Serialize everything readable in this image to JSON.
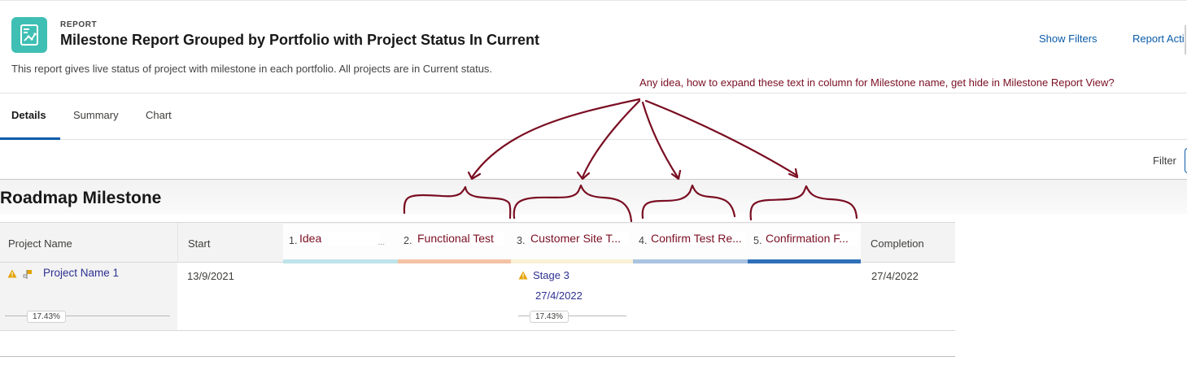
{
  "header": {
    "eyebrow": "REPORT",
    "title": "Milestone Report Grouped by Portfolio with Project Status In Current",
    "description": "This report gives live status of project with milestone in each portfolio. All projects are in Current status.",
    "show_filters": "Show Filters",
    "report_actions": "Report Acti",
    "icon": "report-chart-icon"
  },
  "annotation": "Any idea, how to expand these text in column for Milestone name, get hide in Milestone Report View?",
  "tabs": [
    {
      "label": "Details",
      "active": true
    },
    {
      "label": "Summary",
      "active": false
    },
    {
      "label": "Chart",
      "active": false
    }
  ],
  "filter_label": "Filter",
  "section_title": "Roadmap Milestone",
  "table": {
    "columns": {
      "project": "Project Name",
      "start": "Start",
      "completion": "Completion"
    },
    "stages": [
      {
        "num": "1.",
        "name": "Idea",
        "dots": "...",
        "color": "#bfe3ea"
      },
      {
        "num": "2.",
        "name": "Functional Test",
        "color": "#f5c2a6"
      },
      {
        "num": "3.",
        "name": "Customer Site T...",
        "color": "#f9f1d4"
      },
      {
        "num": "4.",
        "name": "Confirm Test Re...",
        "color": "#aac3e0"
      },
      {
        "num": "5.",
        "name": "Confirmation F...",
        "color": "#2f70b8"
      }
    ],
    "row": {
      "project_name": "Project Name 1",
      "project_pct": "17.43%",
      "start": "13/9/2021",
      "stage_label": "Stage 3",
      "stage_date": "27/4/2022",
      "stage_pct": "17.43%",
      "completion": "27/4/2022"
    }
  },
  "colors": {
    "brand": "#0b5cab",
    "icon_bg": "#3fbfb4",
    "annotation": "#7a0e22",
    "warning": "#e4a201"
  }
}
